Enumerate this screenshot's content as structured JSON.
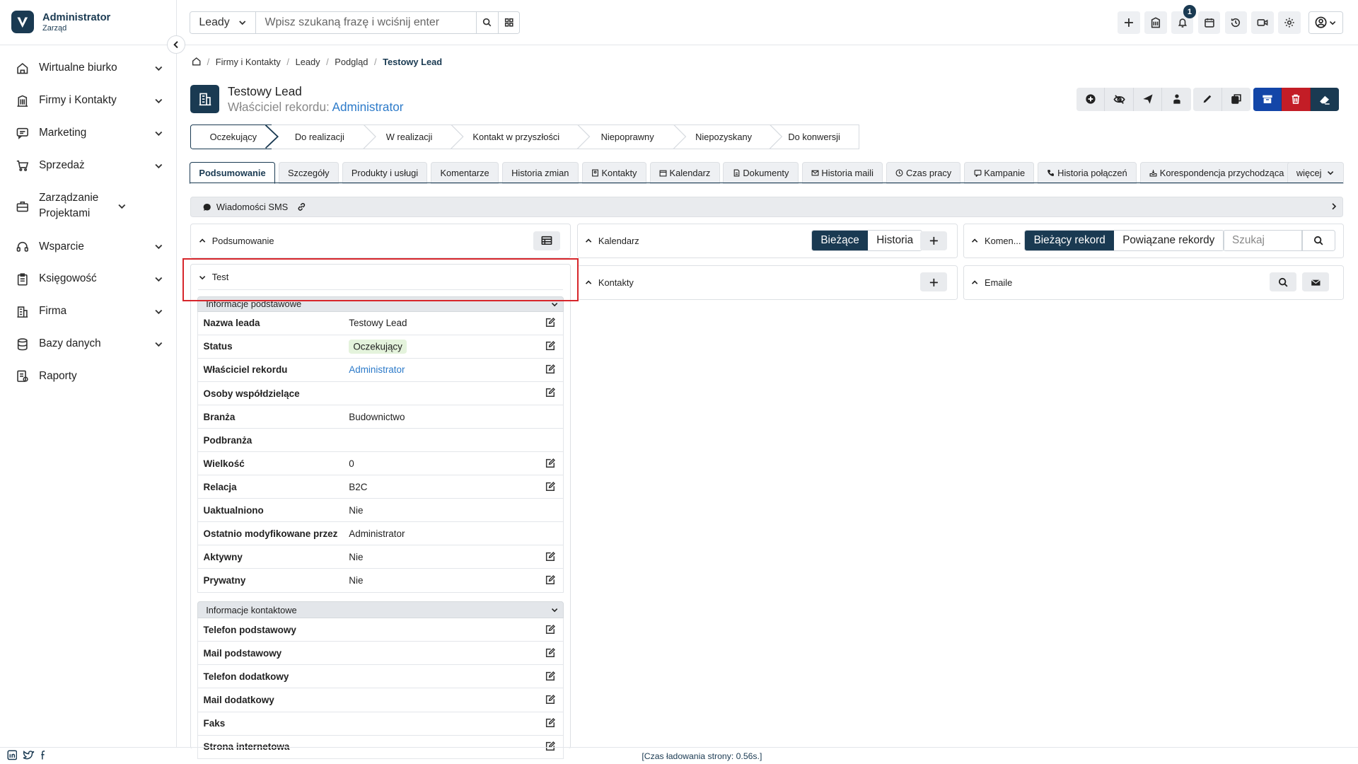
{
  "sidebar": {
    "brand_name": "Administrator",
    "brand_sub": "Zarząd",
    "items": [
      {
        "label": "Wirtualne biurko",
        "icon": "home-icon"
      },
      {
        "label": "Firmy i Kontakty",
        "icon": "building-icon"
      },
      {
        "label": "Marketing",
        "icon": "chat-icon"
      },
      {
        "label": "Sprzedaż",
        "icon": "cart-icon"
      },
      {
        "label": "Zarządzanie Projektami",
        "icon": "briefcase-icon"
      },
      {
        "label": "Wsparcie",
        "icon": "headset-icon"
      },
      {
        "label": "Księgowość",
        "icon": "clipboard-icon"
      },
      {
        "label": "Firma",
        "icon": "company-icon"
      },
      {
        "label": "Bazy danych",
        "icon": "database-icon"
      },
      {
        "label": "Raporty",
        "icon": "report-icon"
      }
    ]
  },
  "topbar": {
    "module": "Leady",
    "search_placeholder": "Wpisz szukaną frazę i wciśnij enter",
    "notifications_count": "1"
  },
  "breadcrumb": {
    "items": [
      "Firmy i Kontakty",
      "Leady",
      "Podgląd"
    ],
    "current": "Testowy Lead"
  },
  "record": {
    "title": "Testowy Lead",
    "owner_label": "Właściciel rekordu:",
    "owner_value": "Administrator"
  },
  "stages": [
    "Oczekujący",
    "Do realizacji",
    "W realizacji",
    "Kontakt w przyszłości",
    "Niepoprawny",
    "Niepozyskany",
    "Do konwersji"
  ],
  "tabs": [
    "Podsumowanie",
    "Szczegóły",
    "Produkty i usługi",
    "Komentarze",
    "Historia zmian",
    "Kontakty",
    "Kalendarz",
    "Dokumenty",
    "Historia maili",
    "Czas pracy",
    "Kampanie",
    "Historia połączeń",
    "Korespondencja przychodząca"
  ],
  "tab_more": "więcej",
  "sms_bar": "Wiadomości SMS",
  "panels": {
    "summary": "Podsumowanie",
    "test": "Test",
    "calendar": "Kalendarz",
    "calendar_current": "Bieżące",
    "calendar_history": "Historia",
    "contacts": "Kontakty",
    "comments": "Komen...",
    "comments_current": "Bieżący rekord",
    "comments_related": "Powiązane rekordy",
    "comments_search_placeholder": "Szukaj",
    "emails": "Emaile"
  },
  "basic_info": {
    "title": "Informacje podstawowe",
    "fields": [
      {
        "label": "Nazwa leada",
        "value": "Testowy Lead"
      },
      {
        "label": "Status",
        "value": "Oczekujący"
      },
      {
        "label": "Właściciel rekordu",
        "value": "Administrator"
      },
      {
        "label": "Osoby współdzielące",
        "value": ""
      },
      {
        "label": "Branża",
        "value": "Budownictwo"
      },
      {
        "label": "Podbranża",
        "value": ""
      },
      {
        "label": "Wielkość",
        "value": "0"
      },
      {
        "label": "Relacja",
        "value": "B2C"
      },
      {
        "label": "Uaktualniono",
        "value": "Nie"
      },
      {
        "label": "Ostatnio modyfikowane przez",
        "value": "Administrator"
      },
      {
        "label": "Aktywny",
        "value": "Nie"
      },
      {
        "label": "Prywatny",
        "value": "Nie"
      }
    ]
  },
  "contact_info": {
    "title": "Informacje kontaktowe",
    "fields": [
      {
        "label": "Telefon podstawowy",
        "value": ""
      },
      {
        "label": "Mail podstawowy",
        "value": ""
      },
      {
        "label": "Telefon dodatkowy",
        "value": ""
      },
      {
        "label": "Mail dodatkowy",
        "value": ""
      },
      {
        "label": "Faks",
        "value": ""
      },
      {
        "label": "Strona internetowa",
        "value": ""
      }
    ]
  },
  "footer": {
    "load_time": "[Czas ładowania strony: 0.56s.]"
  }
}
